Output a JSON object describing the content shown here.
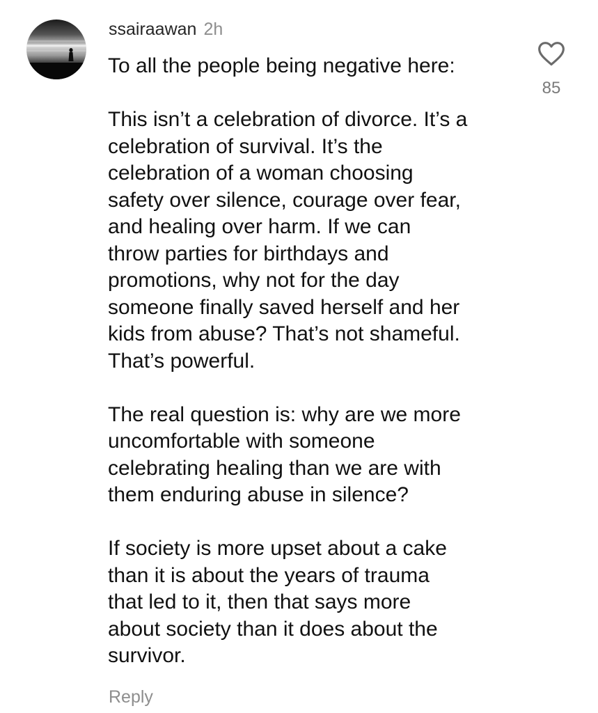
{
  "comment": {
    "username": "ssairaawan",
    "timestamp": "2h",
    "paragraphs": [
      "To all the people being negative here:",
      "This isn’t a celebration of divorce. It’s a\ncelebration of survival. It’s the\ncelebration of a woman choosing\nsafety over silence, courage over fear,\nand healing over harm. If we can\nthrow parties for birthdays and\npromotions, why not for the day\nsomeone finally saved herself and her\nkids from abuse? That’s not shameful.\nThat’s powerful.",
      "The real question is: why are we more\nuncomfortable with someone\ncelebrating healing than we are with\nthem enduring abuse in silence?",
      "If society is more upset about a cake\nthan it is about the years of trauma\nthat led to it, then that says more\nabout society than it does about the\nsurvivor."
    ],
    "like_icon": "heart-outline-icon",
    "like_count": "85",
    "reply_label": "Reply"
  },
  "colors": {
    "text": "#111111",
    "muted": "#8e8e8e",
    "like_count": "#7a7a7a"
  }
}
